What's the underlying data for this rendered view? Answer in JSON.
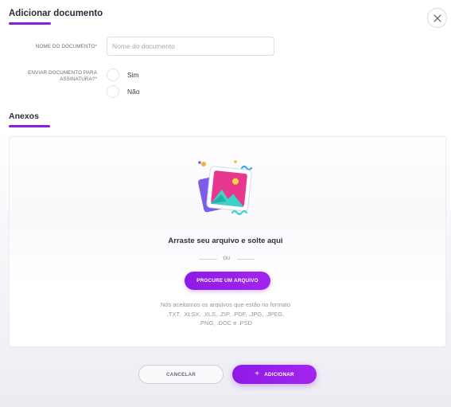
{
  "modal": {
    "title": "Adicionar documento",
    "close_icon": "close-icon"
  },
  "form": {
    "doc_name_label": "NOME DO DOCUMENTO",
    "doc_name_placeholder": "Nome do documento",
    "doc_name_value": "",
    "signature_label_line1": "ENVIAR DOCUMENTO PARA",
    "signature_label_line2": "ASSINATURA?",
    "required_mark": "*",
    "options": [
      {
        "label": "Sim",
        "selected": false
      },
      {
        "label": "Não",
        "selected": false
      }
    ]
  },
  "attachments": {
    "title": "Anexos",
    "illustration_icon": "image-upload-icon",
    "drop_title": "Arraste seu arquivo e solte aqui",
    "or_text": "OU",
    "browse_label": "PROCURE UM ARQUIVO",
    "formats_text": "Nós aceitamos os arquivos que estão no formato .TXT, .XLSX, .XLS, .ZIP, .PDF, .JPG, .JPEG, .PNG, .DOC e .PSD"
  },
  "footer": {
    "cancel_label": "CANCELAR",
    "add_label": "ADICIONAR",
    "add_icon": "plus-icon"
  },
  "colors": {
    "accent": "#8a1ce3",
    "required": "#d63a8a"
  }
}
